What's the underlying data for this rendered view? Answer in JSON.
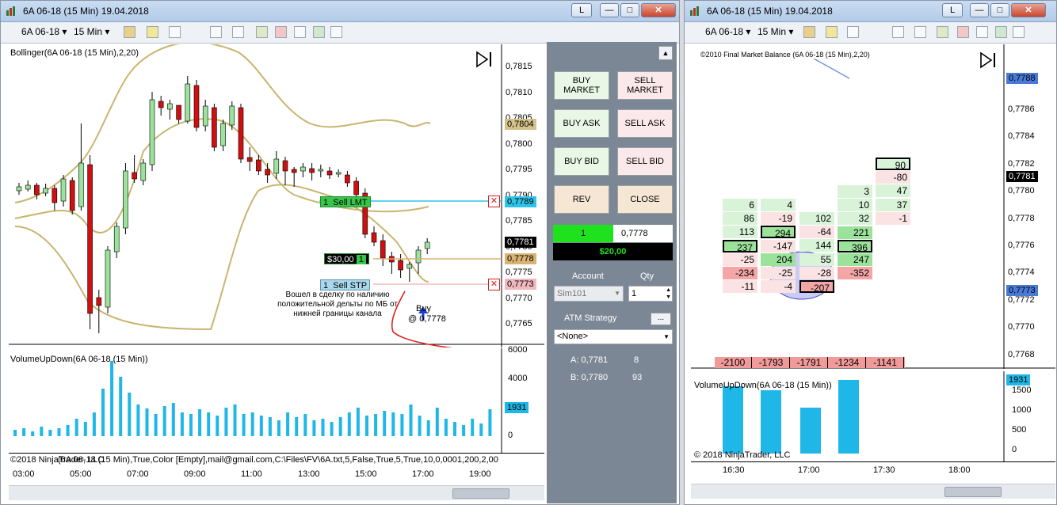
{
  "left_window": {
    "title": "6A 06-18 (15 Min)  19.04.2018",
    "toolbar": {
      "instrument": "6A 06-18",
      "interval": "15 Min"
    },
    "indicator_label": "Bollinger(6A 06-18 (15 Min),2,20)",
    "volume_label": "VolumeUpDown(6A 06-18 (15 Min))",
    "footer_text": "©2018 NinjaTrader, LLC",
    "footer_text2": "(6A 06-18 (15 Min),True,Color [Empty],mail@gmail.com,C:\\Files\\FV\\6A.txt,5,False,True,5,True,10,0,0001,200,2,00",
    "y_ticks": [
      "0,7815",
      "0,7810",
      "0,7805",
      "0,7800",
      "0,7795",
      "0,7790",
      "0,7785",
      "0,7780",
      "0,7775",
      "0,7770",
      "0,7765"
    ],
    "vol_ticks": [
      "6000",
      "4000",
      "2000",
      "0"
    ],
    "x_ticks": [
      "03:00",
      "05:00",
      "07:00",
      "09:00",
      "11:00",
      "13:00",
      "15:00",
      "17:00",
      "19:00"
    ],
    "price_tags": {
      "upper": "0,7804",
      "sell_lmt": "0,7789",
      "last": "0,7781",
      "entry": "0,7778",
      "sell_stp": "0,7773",
      "vol": "1931"
    },
    "orders": {
      "sell_lmt": "Sell LMT",
      "sell_stp": "Sell STP",
      "qty": "1",
      "pnl": "$30,00"
    },
    "annotation": "Вошел в сделку по наличию положительной дельты по МБ от нижней границы канала",
    "buy_marker": "Buy",
    "buy_price": "@ 0,7778",
    "L_label": "L"
  },
  "order_panel": {
    "buy_market": "BUY MARKET",
    "sell_market": "SELL MARKET",
    "buy_ask": "BUY ASK",
    "sell_ask": "SELL ASK",
    "buy_bid": "BUY BID",
    "sell_bid": "SELL BID",
    "rev": "REV",
    "close": "CLOSE",
    "position_qty": "1",
    "position_price": "0,7778",
    "pnl": "$20,00",
    "account_label": "Account",
    "qty_label": "Qty",
    "account_value": "Sim101",
    "qty_value": "1",
    "atm_label": "ATM Strategy",
    "atm_value": "<None>",
    "ask_label": "A: 0,7781",
    "ask_size": "8",
    "bid_label": "B: 0,7780",
    "bid_size": "93",
    "dots": "..."
  },
  "right_window": {
    "title": "6A 06-18 (15 Min)  19.04.2018",
    "toolbar": {
      "instrument": "6A 06-18",
      "interval": "15 Min"
    },
    "indicator_label": "©2010 Final Market Balance (6A 06-18 (15 Min),2,20)",
    "volume_label": "VolumeUpDown(6A 06-18 (15 Min))",
    "footer_text": "© 2018 NinjaTrader, LLC",
    "y_ticks": [
      "0,7786",
      "0,7784",
      "0,7782",
      "0,7780",
      "0,7778",
      "0,7776",
      "0,7774",
      "0,7772",
      "0,7770",
      "0,7768"
    ],
    "vol_ticks": [
      "1500",
      "1000",
      "500",
      "0"
    ],
    "x_ticks": [
      "16:30",
      "17:00",
      "17:30",
      "18:00"
    ],
    "price_tags": {
      "top": "0,7788",
      "last": "0,7781",
      "low": "0,7773",
      "vol": "1931"
    },
    "totals": [
      "-2100",
      "-1793",
      "-1791",
      "-1234",
      "-1141"
    ],
    "cluster_col1": [
      "6",
      "86",
      "113",
      "237",
      "-25",
      "-234",
      "-11"
    ],
    "cluster_col2": [
      "4",
      "-19",
      "294",
      "-147",
      "204",
      "-25",
      "-4"
    ],
    "cluster_col3": [
      "102",
      "-64",
      "144",
      "55",
      "-28",
      "-207"
    ],
    "cluster_col4": [
      "3",
      "10",
      "32",
      "221",
      "396",
      "247",
      "-352"
    ],
    "cluster_col5": [
      "90",
      "-80",
      "47",
      "37",
      "-1"
    ],
    "L_label": "L"
  }
}
